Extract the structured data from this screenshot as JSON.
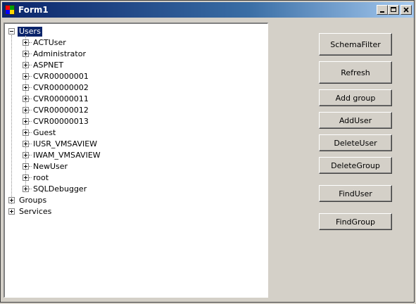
{
  "window": {
    "title": "Form1"
  },
  "tree": {
    "root": {
      "label": "Users",
      "expanded": true
    },
    "users": [
      "ACTUser",
      "Administrator",
      "ASPNET",
      "CVR00000001",
      "CVR00000002",
      "CVR00000011",
      "CVR00000012",
      "CVR00000013",
      "Guest",
      "IUSR_VMSAVIEW",
      "IWAM_VMSAVIEW",
      "NewUser",
      "root",
      "SQLDebugger"
    ],
    "other_roots": [
      "Groups",
      "Services"
    ]
  },
  "buttons": {
    "schema_filter": "SchemaFilter",
    "refresh": "Refresh",
    "add_group": "Add group",
    "add_user": "AddUser",
    "delete_user": "DeleteUser",
    "delete_group": "DeleteGroup",
    "find_user": "FindUser",
    "find_group": "FindGroup"
  },
  "colors": {
    "titlebar_start": "#0a246a",
    "titlebar_end": "#a6caf0",
    "selection": "#0a246a",
    "face": "#d4d0c8"
  }
}
